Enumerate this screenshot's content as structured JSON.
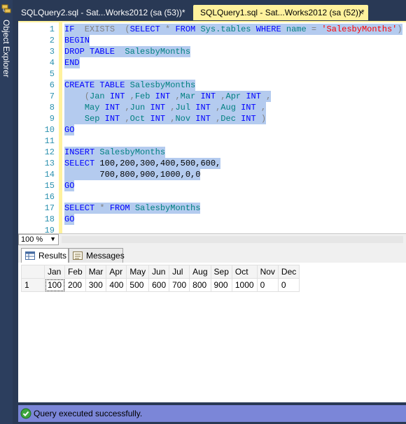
{
  "left_panel": {
    "label": "Object Explorer"
  },
  "tabs": [
    {
      "label": "SQLQuery2.sql - Sat...Works2012 (sa (53))*"
    },
    {
      "label": "SQLQuery1.sql - Sat...Works2012 (sa (52))*",
      "close": "×"
    }
  ],
  "editor": {
    "line_numbers": [
      "1",
      "2",
      "3",
      "4",
      "5",
      "6",
      "7",
      "8",
      "9",
      "10",
      "11",
      "12",
      "13",
      "14",
      "15",
      "16",
      "17",
      "18",
      "19"
    ],
    "lines": [
      [
        [
          "kw",
          "IF"
        ],
        [
          "gr",
          "  EXISTS  "
        ],
        [
          "gr",
          "("
        ],
        [
          "kw",
          "SELECT"
        ],
        [
          "gr",
          " * "
        ],
        [
          "kw",
          "FROM"
        ],
        [
          "bk",
          " "
        ],
        [
          "tx",
          "Sys.tables"
        ],
        [
          "bk",
          " "
        ],
        [
          "kw",
          "WHERE"
        ],
        [
          "bk",
          " "
        ],
        [
          "tx",
          "name"
        ],
        [
          "bk",
          " "
        ],
        [
          "gr",
          "="
        ],
        [
          "bk",
          " "
        ],
        [
          "st",
          "'SalesbyMonths'"
        ],
        [
          "gr",
          ")"
        ]
      ],
      [
        [
          "kw",
          "BEGIN"
        ]
      ],
      [
        [
          "kw",
          "DROP TABLE"
        ],
        [
          "bk",
          "  "
        ],
        [
          "tx",
          "SalesbyMonths"
        ]
      ],
      [
        [
          "kw",
          "END"
        ]
      ],
      [],
      [
        [
          "kw",
          "CREATE TABLE"
        ],
        [
          "bk",
          " "
        ],
        [
          "tx",
          "SalesbyMonths"
        ]
      ],
      [
        [
          "bk",
          "    "
        ],
        [
          "gr",
          "("
        ],
        [
          "tx",
          "Jan"
        ],
        [
          "bk",
          " "
        ],
        [
          "kw",
          "INT"
        ],
        [
          "bk",
          " "
        ],
        [
          "gr",
          ","
        ],
        [
          "tx",
          "Feb"
        ],
        [
          "bk",
          " "
        ],
        [
          "kw",
          "INT"
        ],
        [
          "bk",
          " "
        ],
        [
          "gr",
          ","
        ],
        [
          "tx",
          "Mar"
        ],
        [
          "bk",
          " "
        ],
        [
          "kw",
          "INT"
        ],
        [
          "bk",
          " "
        ],
        [
          "gr",
          ","
        ],
        [
          "tx",
          "Apr"
        ],
        [
          "bk",
          " "
        ],
        [
          "kw",
          "INT"
        ],
        [
          "bk",
          " "
        ],
        [
          "gr",
          ","
        ]
      ],
      [
        [
          "bk",
          "    "
        ],
        [
          "tx",
          "May"
        ],
        [
          "bk",
          " "
        ],
        [
          "kw",
          "INT"
        ],
        [
          "bk",
          " "
        ],
        [
          "gr",
          ","
        ],
        [
          "tx",
          "Jun"
        ],
        [
          "bk",
          " "
        ],
        [
          "kw",
          "INT"
        ],
        [
          "bk",
          " "
        ],
        [
          "gr",
          ","
        ],
        [
          "tx",
          "Jul"
        ],
        [
          "bk",
          " "
        ],
        [
          "kw",
          "INT"
        ],
        [
          "bk",
          " "
        ],
        [
          "gr",
          ","
        ],
        [
          "tx",
          "Aug"
        ],
        [
          "bk",
          " "
        ],
        [
          "kw",
          "INT"
        ],
        [
          "bk",
          " "
        ],
        [
          "gr",
          ","
        ]
      ],
      [
        [
          "bk",
          "    "
        ],
        [
          "tx",
          "Sep"
        ],
        [
          "bk",
          " "
        ],
        [
          "kw",
          "INT"
        ],
        [
          "bk",
          " "
        ],
        [
          "gr",
          ","
        ],
        [
          "tx",
          "Oct"
        ],
        [
          "bk",
          " "
        ],
        [
          "kw",
          "INT"
        ],
        [
          "bk",
          " "
        ],
        [
          "gr",
          ","
        ],
        [
          "tx",
          "Nov"
        ],
        [
          "bk",
          " "
        ],
        [
          "kw",
          "INT"
        ],
        [
          "bk",
          " "
        ],
        [
          "gr",
          ","
        ],
        [
          "tx",
          "Dec"
        ],
        [
          "bk",
          " "
        ],
        [
          "kw",
          "INT"
        ],
        [
          "bk",
          " "
        ],
        [
          "gr",
          ")"
        ]
      ],
      [
        [
          "kw",
          "GO"
        ]
      ],
      [],
      [
        [
          "kw",
          "INSERT"
        ],
        [
          "bk",
          " "
        ],
        [
          "tx",
          "SalesbyMonths"
        ]
      ],
      [
        [
          "kw",
          "SELECT"
        ],
        [
          "bk",
          " 100,200,300,400,500,600,"
        ]
      ],
      [
        [
          "bk",
          "       700,800,900,1000,0,0"
        ]
      ],
      [
        [
          "kw",
          "GO"
        ]
      ],
      [],
      [
        [
          "kw",
          "SELECT"
        ],
        [
          "gr",
          " * "
        ],
        [
          "kw",
          "FROM"
        ],
        [
          "bk",
          " "
        ],
        [
          "tx",
          "SalesbyMonths"
        ]
      ],
      [
        [
          "kw",
          "GO"
        ]
      ],
      []
    ]
  },
  "zoom": {
    "value": "100 %"
  },
  "results_tabs": [
    {
      "label": "Results"
    },
    {
      "label": "Messages"
    }
  ],
  "results": {
    "columns": [
      "Jan",
      "Feb",
      "Mar",
      "Apr",
      "May",
      "Jun",
      "Jul",
      "Aug",
      "Sep",
      "Oct",
      "Nov",
      "Dec"
    ],
    "rows": [
      {
        "num": "1",
        "cells": [
          "100",
          "200",
          "300",
          "400",
          "500",
          "600",
          "700",
          "800",
          "900",
          "1000",
          "0",
          "0"
        ]
      }
    ]
  },
  "status": {
    "message": "Query executed successfully."
  },
  "colors": {
    "keyword": "#0000ff",
    "operator": "#808080",
    "string": "#ff0000",
    "identifier": "#008080",
    "selection": "#b4cbef",
    "line_number": "#2b91af",
    "active_tab": "#fff29d",
    "status_bar": "#7b86d8",
    "chrome": "#293955"
  },
  "icons": {
    "object_explorer": "object-explorer-icon",
    "results": "grid-icon",
    "messages": "messages-icon",
    "status": "check-circle-icon"
  }
}
